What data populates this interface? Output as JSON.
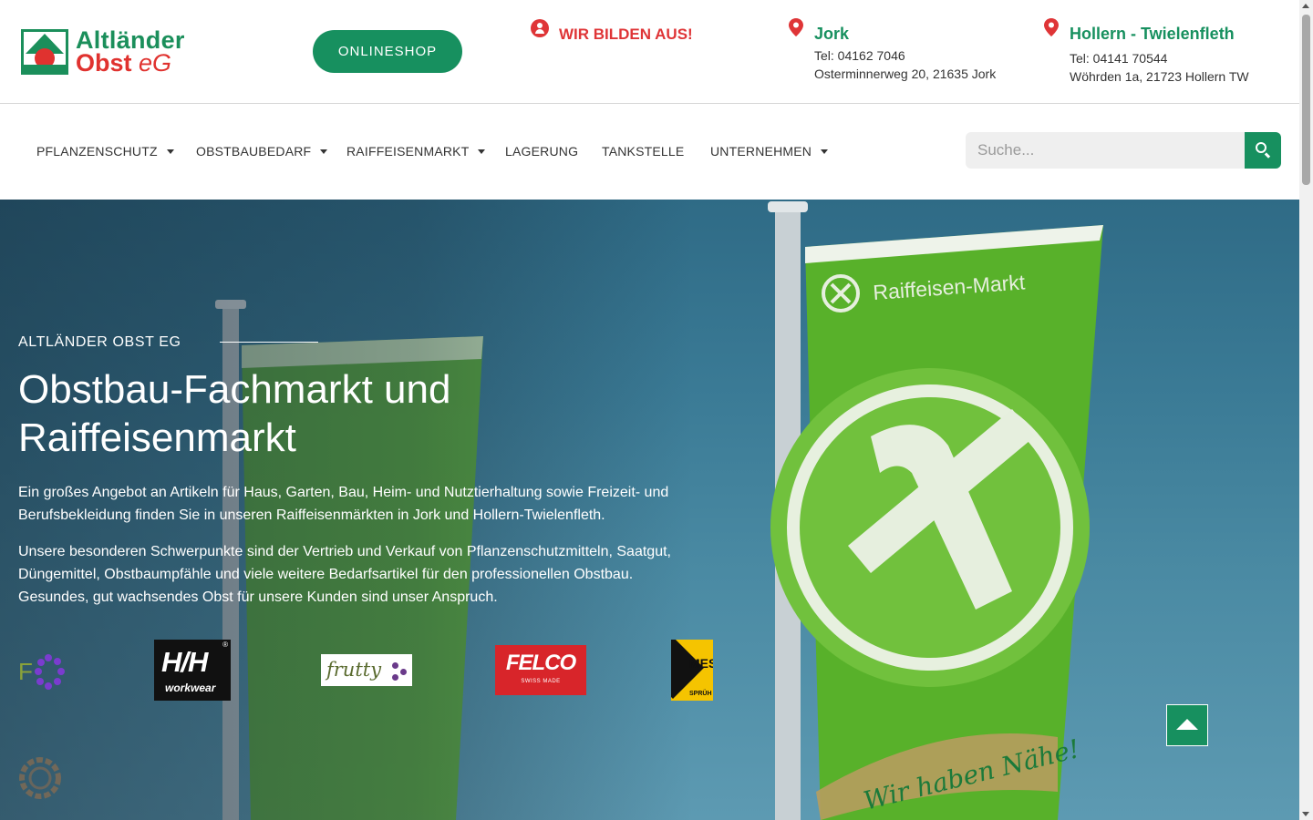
{
  "header": {
    "logo": {
      "line1": "Altländer",
      "line2_bold": "Obst",
      "line2_suffix": " eG"
    },
    "onlineshop_label": "ONLINESHOP",
    "azubi_label": "WIR BILDEN AUS!",
    "locations": [
      {
        "name": "Jork",
        "tel": "Tel: 04162 7046",
        "address": "Osterminnerweg 20, 21635 Jork"
      },
      {
        "name": "Hollern - Twielenfleth",
        "tel": "Tel: 04141 70544",
        "address": "Wöhrden 1a, 21723 Hollern TW"
      }
    ]
  },
  "nav": {
    "items": [
      {
        "label": "PFLANZENSCHUTZ",
        "has_dropdown": true
      },
      {
        "label": "OBSTBAUBEDARF",
        "has_dropdown": true
      },
      {
        "label": "RAIFFEISENMARKT",
        "has_dropdown": true
      },
      {
        "label": "LAGERUNG",
        "has_dropdown": false
      },
      {
        "label": "TANKSTELLE",
        "has_dropdown": false
      },
      {
        "label": "UNTERNEHMEN",
        "has_dropdown": true
      }
    ],
    "search": {
      "placeholder": "Suche...",
      "value": ""
    }
  },
  "hero": {
    "eyebrow": "ALTLÄNDER OBST EG",
    "headline": "Obstbau-Fachmarkt und Raiffeisenmarkt",
    "paragraph1": "Ein großes Angebot an Artikeln für Haus, Garten, Bau, Heim- und Nutztierhaltung sowie Freizeit- und Berufsbekleidung finden Sie in unseren Raiffeisenmärkten in Jork und Hollern-Twielenfleth.",
    "paragraph2": "Unsere besonderen Schwerpunkte sind der Vertrieb und Verkauf von Pflanzenschutzmitteln, Saatgut, Düngemittel, Obstbaumpfähle und viele weitere Bedarfsartikel für den professionellen Obstbau. Gesundes, gut wachsendes Obst für unsere Kunden sind unser Anspruch.",
    "flag_text": "Raiffeisen-Markt",
    "banner_text": "Wir haben Nähe!",
    "brands": {
      "partial": "F",
      "hh_big": "H/H",
      "hh_small": "workwear",
      "hh_reg": "®",
      "frutty": "frutty",
      "felco": "FELCO",
      "felco_sub": "SWISS MADE",
      "mes": "MES",
      "mes_sub": "SPRÜH"
    }
  },
  "colors": {
    "brand_green": "#17905f",
    "brand_red": "#df3537"
  },
  "icons": {
    "azubi": "user-circle-icon",
    "location": "map-pin-icon",
    "search": "search-icon",
    "back_to_top": "arrow-up-icon",
    "cookie": "cookie-settings-icon"
  }
}
